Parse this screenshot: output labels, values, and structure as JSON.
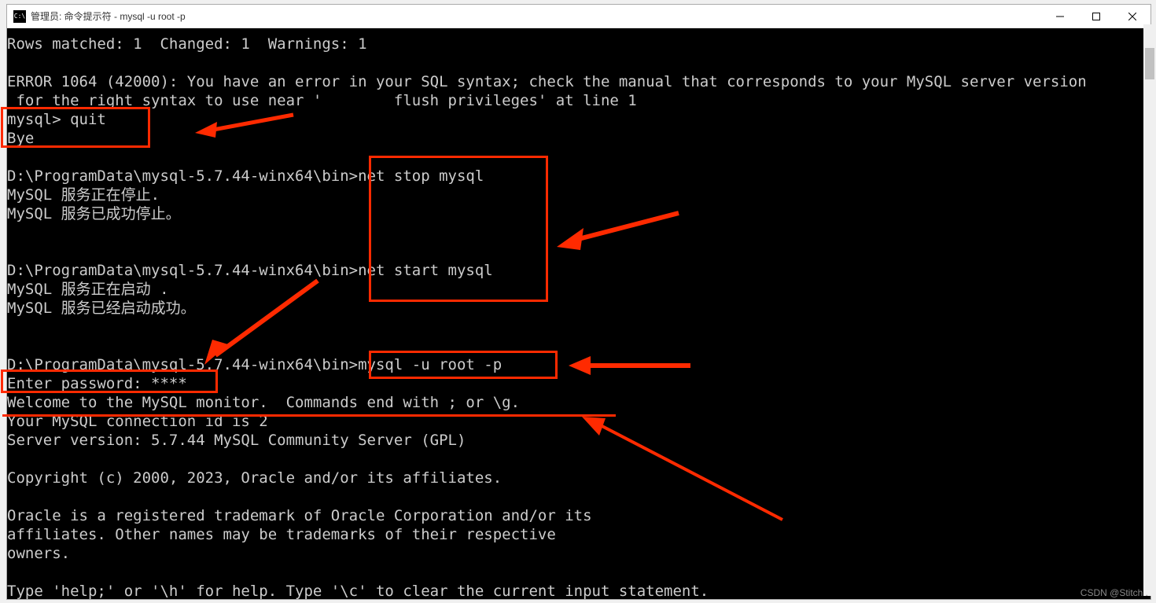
{
  "window": {
    "icon_text": "C:\\",
    "title": "管理员: 命令提示符 - mysql  -u root -p"
  },
  "terminal": {
    "lines": [
      "Rows matched: 1  Changed: 1  Warnings: 1",
      "",
      "ERROR 1064 (42000): You have an error in your SQL syntax; check the manual that corresponds to your MySQL server version",
      " for the right syntax to use near '        flush privileges' at line 1",
      "mysql> quit",
      "Bye",
      "",
      "D:\\ProgramData\\mysql-5.7.44-winx64\\bin>net stop mysql",
      "MySQL 服务正在停止.",
      "MySQL 服务已成功停止。",
      "",
      "",
      "D:\\ProgramData\\mysql-5.7.44-winx64\\bin>net start mysql",
      "MySQL 服务正在启动 .",
      "MySQL 服务已经启动成功。",
      "",
      "",
      "D:\\ProgramData\\mysql-5.7.44-winx64\\bin>mysql -u root -p",
      "Enter password: ****",
      "Welcome to the MySQL monitor.  Commands end with ; or \\g.",
      "Your MySQL connection id is 2",
      "Server version: 5.7.44 MySQL Community Server (GPL)",
      "",
      "Copyright (c) 2000, 2023, Oracle and/or its affiliates.",
      "",
      "Oracle is a registered trademark of Oracle Corporation and/or its",
      "affiliates. Other names may be trademarks of their respective",
      "owners.",
      "",
      "Type 'help;' or '\\h' for help. Type '\\c' to clear the current input statement."
    ]
  },
  "watermark": "CSDN @Stitch ."
}
